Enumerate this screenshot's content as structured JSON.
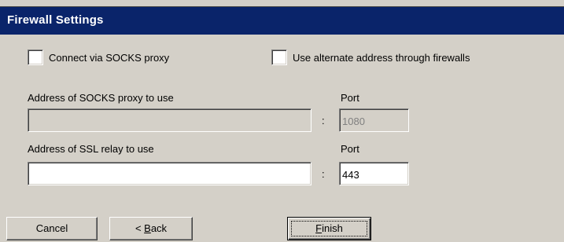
{
  "window": {
    "title": "Firewall Settings",
    "titlebar_color": "#0a246a",
    "background_color": "#d4d0c8"
  },
  "options": {
    "socks_checkbox_label": "Connect via SOCKS proxy",
    "socks_checked": false,
    "alternate_checkbox_label": "Use alternate address through firewalls",
    "alternate_checked": false
  },
  "socks": {
    "address_label": "Address of SOCKS proxy to use",
    "address_value": "",
    "separator": ":",
    "port_label": "Port",
    "port_value": "1080",
    "enabled": false
  },
  "ssl": {
    "address_label": "Address of SSL relay to use",
    "address_value": "",
    "separator": ":",
    "port_label": "Port",
    "port_value": "443",
    "enabled": true
  },
  "buttons": {
    "cancel": "Cancel",
    "back_prefix": "< ",
    "back_mnemonic": "B",
    "back_rest": "ack",
    "finish_mnemonic": "F",
    "finish_rest": "inish"
  }
}
